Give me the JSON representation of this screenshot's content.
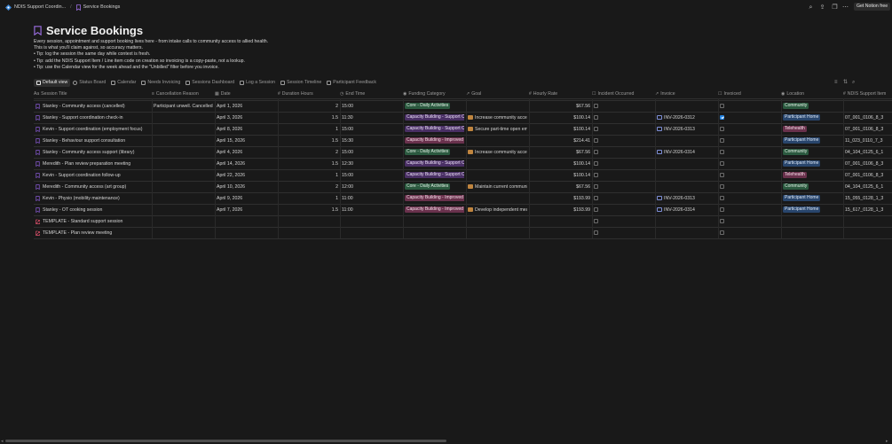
{
  "breadcrumb": {
    "workspace": "NDIS Support Coordin...",
    "separator": "/",
    "page": "Service Bookings"
  },
  "topbar": {
    "get_notion": "Get Notion free"
  },
  "page": {
    "title": "Service Bookings",
    "description": [
      "Every session, appointment and support booking lives here - from intake calls to community access to allied health.",
      "This is what you'll claim against, so accuracy matters.",
      "• Tip: log the session the same day while context is fresh.",
      "• Tip: add the NDIS Support Item / Line item code on creation so invoicing is a copy-paste, not a lookup.",
      "• Tip: use the Calendar view for the week ahead and the \"Unbilled\" filter before you invoice."
    ]
  },
  "views": [
    "Default view",
    "Status Board",
    "Calendar",
    "Needs Invoicing",
    "Sessions Dashboard",
    "Log a Session",
    "Session Timeline",
    "Participant Feedback"
  ],
  "columns": [
    "Session Title",
    "Cancellation Reason",
    "Date",
    "Duration Hours",
    "End Time",
    "Funding Category",
    "Goal",
    "Hourly Rate",
    "Incident Occurred",
    "Invoice",
    "Invoiced",
    "Location",
    "NDIS Support Item"
  ],
  "rows": [
    {
      "title": "Stanley - Community access (cancelled)",
      "cancel": "Participant unwell. Cancelled <",
      "date": "April 1, 2026",
      "hours": "2",
      "end": "15:00",
      "funding": "Core - Daily Activities",
      "fcolor": "green",
      "goal": "",
      "rate": "$67.56",
      "incident": false,
      "invoice": "",
      "invoiced": false,
      "location": "Community",
      "lcolor": "green",
      "item": "",
      "icon": "booking"
    },
    {
      "title": "Stanley - Support coordination check-in",
      "cancel": "",
      "date": "April 3, 2026",
      "hours": "1.5",
      "end": "11:30",
      "funding": "Capacity Building - Support Coordination",
      "fcolor": "purple",
      "goal": "Increase community access",
      "rate": "$100.14",
      "incident": false,
      "invoice": "INV-2026-0312",
      "invoiced": true,
      "location": "Participant Home",
      "lcolor": "blue",
      "item": "07_001_0106_8_3",
      "icon": "booking"
    },
    {
      "title": "Kevin - Support coordination (employment focus)",
      "cancel": "",
      "date": "April 8, 2026",
      "hours": "1",
      "end": "15:00",
      "funding": "Capacity Building - Support Coordination",
      "fcolor": "purple",
      "goal": "Secure part-time open employment",
      "rate": "$100.14",
      "incident": false,
      "invoice": "INV-2026-0313",
      "invoiced": false,
      "location": "Telehealth",
      "lcolor": "pink",
      "item": "07_001_0106_8_3",
      "icon": "booking"
    },
    {
      "title": "Stanley - Behaviour support consultation",
      "cancel": "",
      "date": "April 15, 2026",
      "hours": "1.5",
      "end": "15:30",
      "funding": "Capacity Building - Improved Relationships",
      "fcolor": "pink",
      "goal": "",
      "rate": "$214.41",
      "incident": false,
      "invoice": "",
      "invoiced": false,
      "location": "Participant Home",
      "lcolor": "blue",
      "item": "11_023_0110_7_3",
      "icon": "booking"
    },
    {
      "title": "Stanley - Community access support (library)",
      "cancel": "",
      "date": "April 4, 2026",
      "hours": "2",
      "end": "15:00",
      "funding": "Core - Daily Activities",
      "fcolor": "green",
      "goal": "Increase community access",
      "rate": "$67.56",
      "incident": false,
      "invoice": "INV-2026-0314",
      "invoiced": false,
      "location": "Community",
      "lcolor": "green",
      "item": "04_104_0125_6_1",
      "icon": "booking"
    },
    {
      "title": "Meredith - Plan review preparation meeting",
      "cancel": "",
      "date": "April 14, 2026",
      "hours": "1.5",
      "end": "12:30",
      "funding": "Capacity Building - Support Coordination",
      "fcolor": "purple",
      "goal": "",
      "rate": "$100.14",
      "incident": false,
      "invoice": "",
      "invoiced": false,
      "location": "Participant Home",
      "lcolor": "blue",
      "item": "07_001_0106_8_3",
      "icon": "booking"
    },
    {
      "title": "Kevin - Support coordination follow-up",
      "cancel": "",
      "date": "April 22, 2026",
      "hours": "1",
      "end": "15:00",
      "funding": "Capacity Building - Support Coordination",
      "fcolor": "purple",
      "goal": "",
      "rate": "$100.14",
      "incident": false,
      "invoice": "",
      "invoiced": false,
      "location": "Telehealth",
      "lcolor": "pink",
      "item": "07_001_0106_8_3",
      "icon": "booking"
    },
    {
      "title": "Meredith - Community access (art group)",
      "cancel": "",
      "date": "April 10, 2026",
      "hours": "2",
      "end": "12:00",
      "funding": "Core - Daily Activities",
      "fcolor": "green",
      "goal": "Maintain current community connections",
      "rate": "$67.56",
      "incident": false,
      "invoice": "",
      "invoiced": false,
      "location": "Community",
      "lcolor": "green",
      "item": "04_104_0125_6_1",
      "icon": "booking"
    },
    {
      "title": "Kevin - Physio (mobility maintenance)",
      "cancel": "",
      "date": "April 9, 2026",
      "hours": "1",
      "end": "11:00",
      "funding": "Capacity Building - Improved Daily Living",
      "fcolor": "pink",
      "goal": "",
      "rate": "$193.99",
      "incident": false,
      "invoice": "INV-2026-0313",
      "invoiced": false,
      "location": "Participant Home",
      "lcolor": "blue",
      "item": "15_055_0128_1_3",
      "icon": "booking"
    },
    {
      "title": "Stanley - OT cooking session",
      "cancel": "",
      "date": "April 7, 2026",
      "hours": "1.5",
      "end": "11:00",
      "funding": "Capacity Building - Improved Daily Living",
      "fcolor": "pink",
      "goal": "Develop independent meal preparation",
      "rate": "$193.99",
      "incident": false,
      "invoice": "INV-2026-0314",
      "invoiced": false,
      "location": "Participant Home",
      "lcolor": "blue",
      "item": "15_617_0128_1_3",
      "icon": "booking"
    },
    {
      "title": "TEMPLATE - Standard support session",
      "cancel": "",
      "date": "",
      "hours": "",
      "end": "",
      "funding": "",
      "fcolor": "",
      "goal": "",
      "rate": "",
      "incident": false,
      "invoice": "",
      "invoiced": false,
      "location": "",
      "lcolor": "",
      "item": "",
      "icon": "template"
    },
    {
      "title": "TEMPLATE - Plan review meeting",
      "cancel": "",
      "date": "",
      "hours": "",
      "end": "",
      "funding": "",
      "fcolor": "",
      "goal": "",
      "rate": "",
      "incident": false,
      "invoice": "",
      "invoiced": false,
      "location": "",
      "lcolor": "",
      "item": "",
      "icon": "template"
    }
  ],
  "colors": {
    "accent": "#2383e2",
    "booking_icon": "#8a5bd6",
    "template_icon": "#e0506b"
  }
}
